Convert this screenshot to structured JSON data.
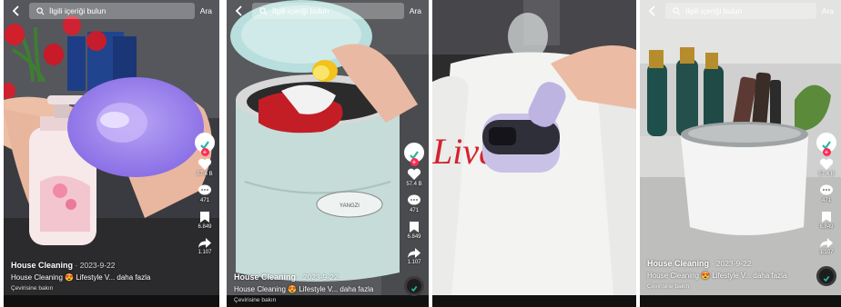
{
  "search": {
    "placeholder": "İlgili içeriği bulun",
    "button": "Ara"
  },
  "videos": [
    {
      "author": "House Cleaning",
      "date": "2023-9-22",
      "text": "House Cleaning 😍 Lifestyle V... daha fazla",
      "translate": "Çevirisine bakın",
      "likes": "57.4 B",
      "comments": "471",
      "saves": "6.849",
      "shares": "1.107"
    },
    {
      "author": "House Cleaning",
      "date": "2023-9-22",
      "text": "House Cleaning 😍 Lifestyle V... daha fazla",
      "translate": "Çevirisine bakın",
      "likes": "57.4 B",
      "comments": "471",
      "saves": "6.849",
      "shares": "1.107"
    },
    {
      "author": "",
      "date": "",
      "text": "",
      "translate": "",
      "likes": "",
      "comments": "",
      "saves": "",
      "shares": ""
    },
    {
      "author": "House Cleaning",
      "date": "2023-9-22",
      "text": "House Cleaning 😍 Lifestyle V... daha fazla",
      "translate": "Çevirisine bakın",
      "likes": "57.4 B",
      "comments": "471",
      "saves": "6.849",
      "shares": "1.107"
    }
  ],
  "product_text": {
    "shirt_print": "Live"
  },
  "colors": {
    "like": "#ffffff",
    "follow": "#fe2c55",
    "avatar": "#2bb3a3"
  }
}
